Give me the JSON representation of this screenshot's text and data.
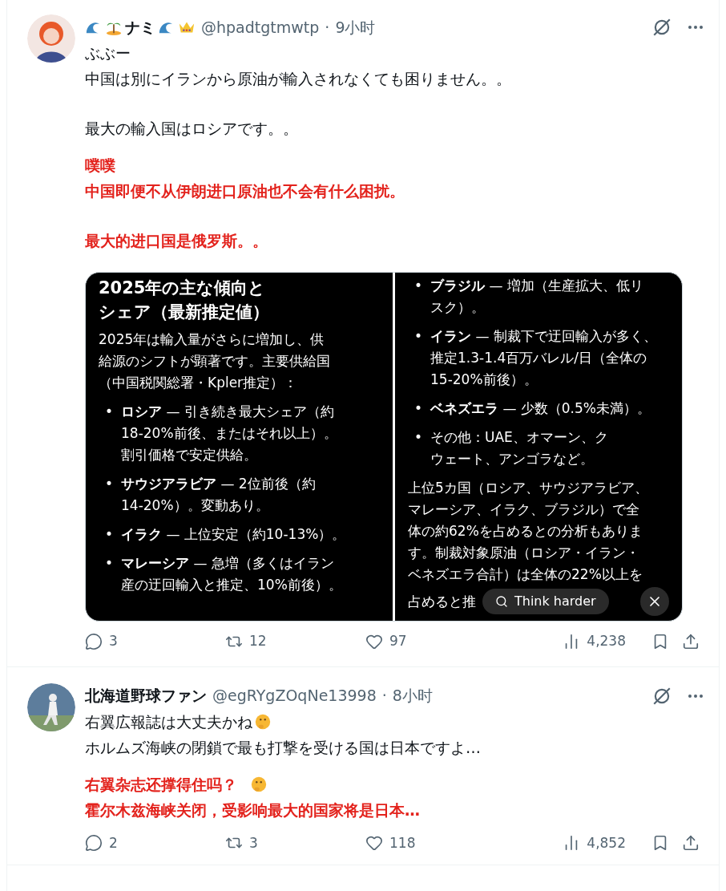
{
  "tweets": [
    {
      "author": {
        "name": "ナミ",
        "handle": "@hpadtgtmwtp",
        "separator": "·",
        "time": "9小时"
      },
      "paragraphs": [
        {
          "kind": "original",
          "lines": [
            {
              "text": "ぶぶー",
              "emoji": false
            },
            {
              "text": "中国は別にイランから原油が輸入されなくても困りません。。",
              "emoji": false
            }
          ]
        },
        {
          "kind": "original",
          "lines": [
            {
              "text": "最大の輸入国はロシアです。。",
              "emoji": false
            }
          ]
        },
        {
          "kind": "translation",
          "lines": [
            {
              "text": "噗噗",
              "emoji": false
            },
            {
              "text": "中国即便不从伊朗进口原油也不会有什么困扰。",
              "emoji": false
            }
          ]
        },
        {
          "kind": "translation",
          "lines": [
            {
              "text": "最大的进口国是俄罗斯。。",
              "emoji": false
            }
          ]
        }
      ],
      "attachment": {
        "kind": "screenshot",
        "bullet_marker": "•",
        "left": {
          "title": [
            "2025年の主な傾向と",
            "シェア（最新推定値）"
          ],
          "intro": [
            "2025年は輸入量がさらに増加し、供",
            "給源のシフトが顕著です。主要供給国",
            "（中国税関総署・Kpler推定）："
          ],
          "bullets": [
            {
              "lines": [
                "**ロシア** — 引き続き最大シェア（約",
                "18-20%前後、またはそれ以上）。",
                "割引価格で安定供給。"
              ]
            },
            {
              "lines": [
                "**サウジアラビア** — 2位前後（約",
                "14-20%）。変動あり。"
              ]
            },
            {
              "lines": [
                "**イラク** — 上位安定（約10-13%）。"
              ]
            },
            {
              "lines": [
                "**マレーシア** — 急増（多くはイラン",
                "産の迂回輸入と推定、10%前後）。"
              ]
            }
          ]
        },
        "right": {
          "bullets": [
            {
              "lines": [
                "**ブラジル** — 増加（生産拡大、低リ",
                "スク）。"
              ]
            },
            {
              "lines": [
                "**イラン** — 制裁下で迂回輸入が多く、",
                "推定1.3-1.4百万バレル/日（全体の",
                "15-20%前後）。"
              ]
            },
            {
              "lines": [
                "**ベネズエラ** — 少数（0.5%未満）。"
              ]
            },
            {
              "lines": [
                "その他：UAE、オマーン、ク",
                "ウェート、アンゴラなど。"
              ]
            }
          ],
          "conclusion": [
            "上位5カ国（ロシア、サウジアラビア、",
            "マレーシア、イラク、ブラジル）で全",
            "体の約62%を占めるとの分析もありま",
            "す。制裁対象原油（ロシア・イラン・",
            "ベネズエラ合計）は全体の22%以上を"
          ],
          "last_line": "占めると推",
          "think_button": "Think harder"
        }
      },
      "stats": [
        {
          "kind": "reply",
          "count": "3"
        },
        {
          "kind": "repost",
          "count": "12"
        },
        {
          "kind": "like",
          "count": "97"
        },
        {
          "kind": "views",
          "count": "4,238"
        }
      ]
    },
    {
      "author": {
        "name": "北海道野球ファン",
        "handle": "@egRYgZOqNe13998",
        "separator": "·",
        "time": "8小时"
      },
      "paragraphs": [
        {
          "kind": "original",
          "lines": [
            {
              "text": "右翼広報誌は大丈夫かね",
              "emoji": true
            },
            {
              "text": "ホルムズ海峡の閉鎖で最も打撃を受ける国は日本ですよ…",
              "emoji": false
            }
          ]
        },
        {
          "kind": "translation",
          "lines": [
            {
              "text": "右翼杂志还撑得住吗？",
              "emoji": true
            },
            {
              "text": "霍尔木兹海峡关闭，受影响最大的国家将是日本…",
              "emoji": false
            }
          ]
        }
      ],
      "stats": [
        {
          "kind": "reply",
          "count": "2"
        },
        {
          "kind": "repost",
          "count": "3"
        },
        {
          "kind": "like",
          "count": "118"
        },
        {
          "kind": "views",
          "count": "4,852"
        }
      ]
    }
  ]
}
